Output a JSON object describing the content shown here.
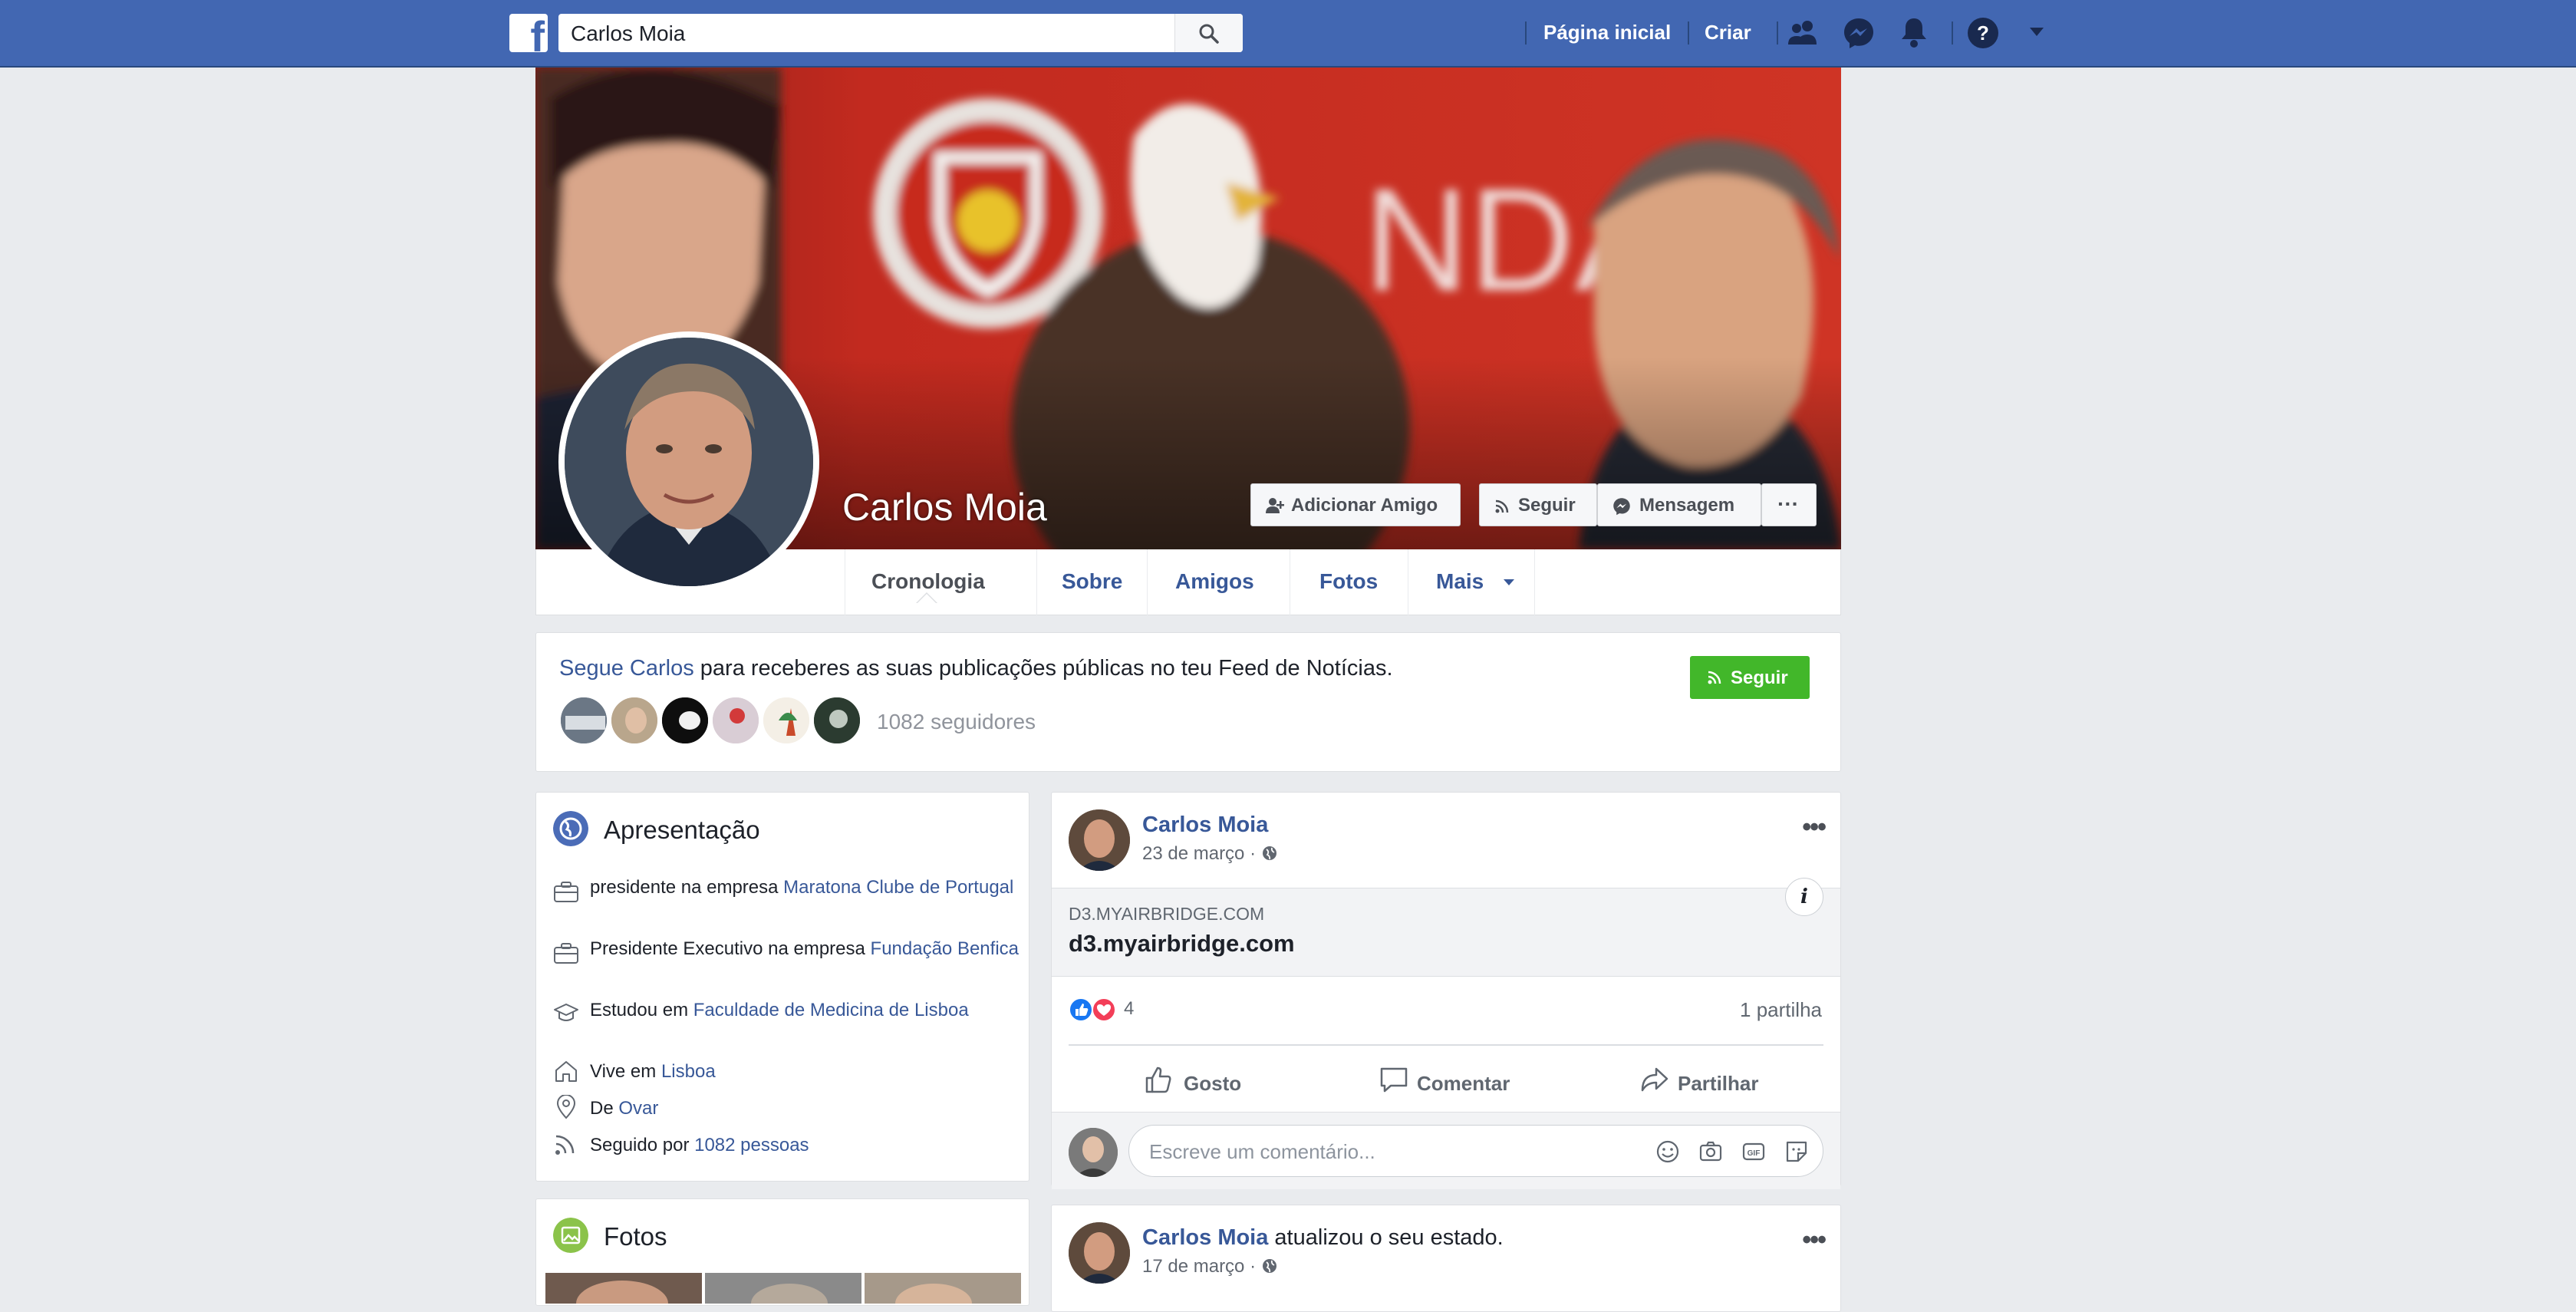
{
  "search": {
    "value": "Carlos Moia"
  },
  "topnav": {
    "home": "Página inicial",
    "create": "Criar"
  },
  "profile": {
    "name": "Carlos Moia"
  },
  "cover_buttons": {
    "add_friend": "Adicionar Amigo",
    "follow": "Seguir",
    "message": "Mensagem",
    "more": "···"
  },
  "tabs": [
    {
      "label": "Cronologia"
    },
    {
      "label": "Sobre"
    },
    {
      "label": "Amigos"
    },
    {
      "label": "Fotos"
    },
    {
      "label": "Mais"
    }
  ],
  "follow_card": {
    "link_text": "Segue Carlos",
    "rest_text": " para receberes as suas publicações públicas no teu Feed de Notícias.",
    "button": "Seguir",
    "followers": "1082 seguidores"
  },
  "intro": {
    "title": "Apresentação",
    "items": [
      {
        "prefix": "presidente na empresa ",
        "link": "Maratona Clube de Portugal",
        "icon": "briefcase-icon"
      },
      {
        "prefix": "Presidente Executivo na empresa ",
        "link": "Fundação Benfica",
        "icon": "briefcase-icon"
      },
      {
        "prefix": "Estudou em ",
        "link": "Faculdade de Medicina de Lisboa",
        "icon": "graduation-cap-icon"
      },
      {
        "prefix": "Vive em ",
        "link": "Lisboa",
        "icon": "home-icon"
      },
      {
        "prefix": "De ",
        "link": "Ovar",
        "icon": "location-pin-icon"
      },
      {
        "prefix": "Seguido por ",
        "link": "1082 pessoas",
        "icon": "rss-icon"
      }
    ]
  },
  "photos_card": {
    "title": "Fotos"
  },
  "posts": [
    {
      "author": "Carlos Moia",
      "date": "23 de março · ",
      "link_domain": "D3.MYAIRBRIDGE.COM",
      "link_title": "d3.myairbridge.com",
      "reactions_count": "4",
      "shares": "1 partilha",
      "actions": {
        "like": "Gosto",
        "comment": "Comentar",
        "share": "Partilhar"
      },
      "comment_placeholder": "Escreve um comentário..."
    },
    {
      "author": "Carlos Moia",
      "action_text": " atualizou o seu estado.",
      "date": "17 de março · "
    }
  ],
  "colors": {
    "brand": "#4267b2",
    "link": "#385898",
    "follow_green": "#42b72a",
    "background": "#e9ebee"
  }
}
